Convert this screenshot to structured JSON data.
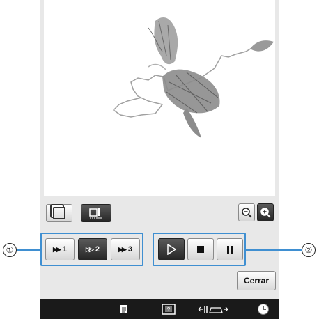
{
  "speed_buttons": [
    {
      "label": "1",
      "selected": false
    },
    {
      "label": "2",
      "selected": true
    },
    {
      "label": "3",
      "selected": false
    }
  ],
  "callouts": {
    "left": "①",
    "right": "②"
  },
  "close_button": "Cerrar",
  "colors": {
    "panel": "#e8e8e8",
    "group_border": "#3f8fd1",
    "bottom_bar": "#1a1a1a",
    "dark_button": "#2e2e2e"
  },
  "icons": {
    "view_toggle": "frame-view-icon",
    "sewing_preview": "needle-preview-icon",
    "zoom_out": "zoom-out-icon",
    "zoom_in": "zoom-in-icon",
    "play": "play-icon",
    "stop": "stop-icon",
    "pause": "pause-icon",
    "bar": [
      "document-icon",
      "help-icon",
      "presser-foot-icon",
      "clock-icon"
    ]
  }
}
